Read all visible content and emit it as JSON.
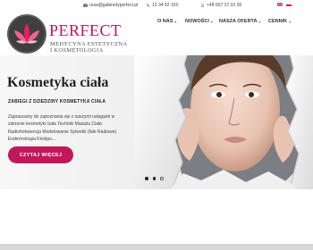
{
  "topbar": {
    "email": "rusa@gabinetyperfect.pl",
    "phone1": "12 34 62 102",
    "phone2": "+48 607 37 33 28"
  },
  "brand": {
    "name": "PERFECT",
    "line1": "MEDYCYNA ESTETYCZNA",
    "line2": "I KOSMETOLOGIA"
  },
  "nav": {
    "about": "O NAS",
    "news": "NOWOŚCI",
    "offer": "NASZA OFERTA",
    "pricing": "CENNIK"
  },
  "hero": {
    "title": "Kosmetyka ciała",
    "subtitle": "ZABIEGI Z DZIEDZINY KOSMETYKA CIAŁA",
    "desc_lines": [
      "Zapraszamy do zapoznania się z naszymi usługami w",
      "zakresie kosmetyki ciała Techniki Masażu Ciała",
      "Radiofrekwencja Modelowanie Sylwetki (fale Radiowe)",
      "Endermologia Kriolipo..."
    ],
    "cta": "CZYTAJ WIĘCEJ"
  },
  "colors": {
    "accent": "#c2185b",
    "hero_bg": "#f0f0f0"
  },
  "icons": [
    "email-icon",
    "phone-icon",
    "mobile-icon",
    "caret-down-icon",
    "flag-uk-icon",
    "flag-pl-icon",
    "lotus-logo"
  ]
}
